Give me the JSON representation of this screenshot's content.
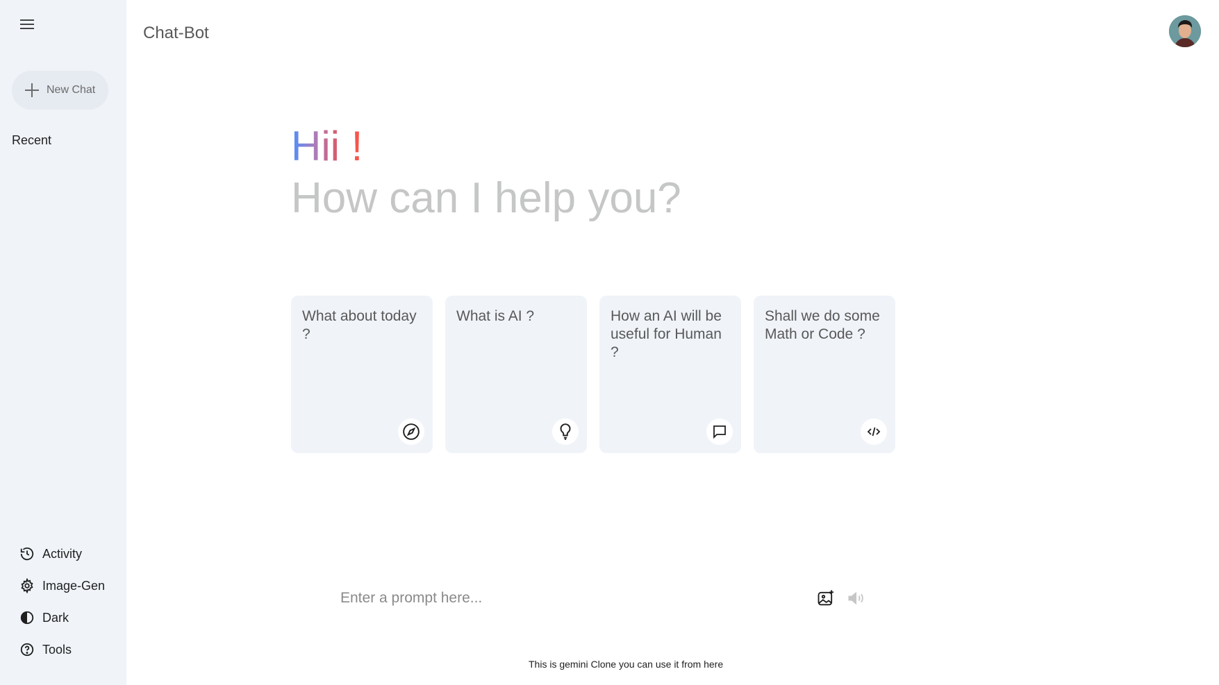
{
  "header": {
    "title": "Chat-Bot"
  },
  "sidebar": {
    "new_chat_label": "New Chat",
    "recent_label": "Recent",
    "items": [
      {
        "label": "Activity",
        "icon": "history-icon"
      },
      {
        "label": "Image-Gen",
        "icon": "gear-icon"
      },
      {
        "label": "Dark",
        "icon": "contrast-icon"
      },
      {
        "label": "Tools",
        "icon": "help-icon"
      }
    ]
  },
  "greeting": {
    "line1": "Hii !",
    "line2": "How can I help you?"
  },
  "cards": [
    {
      "text": "What about today ?",
      "icon": "compass-icon"
    },
    {
      "text": "What is AI ?",
      "icon": "bulb-icon"
    },
    {
      "text": "How an AI will be useful for Human ?",
      "icon": "message-icon"
    },
    {
      "text": "Shall we do some Math or Code ?",
      "icon": "code-icon"
    }
  ],
  "prompt": {
    "placeholder": "Enter a prompt here..."
  },
  "footer": {
    "text": "This is gemini Clone you can use it from here"
  },
  "colors": {
    "sidebar_bg": "#f0f4f9",
    "card_bg": "#f0f4f9",
    "gradient_start": "#4b90ff",
    "gradient_end": "#ff5546",
    "muted_text": "#c4c7c5"
  }
}
